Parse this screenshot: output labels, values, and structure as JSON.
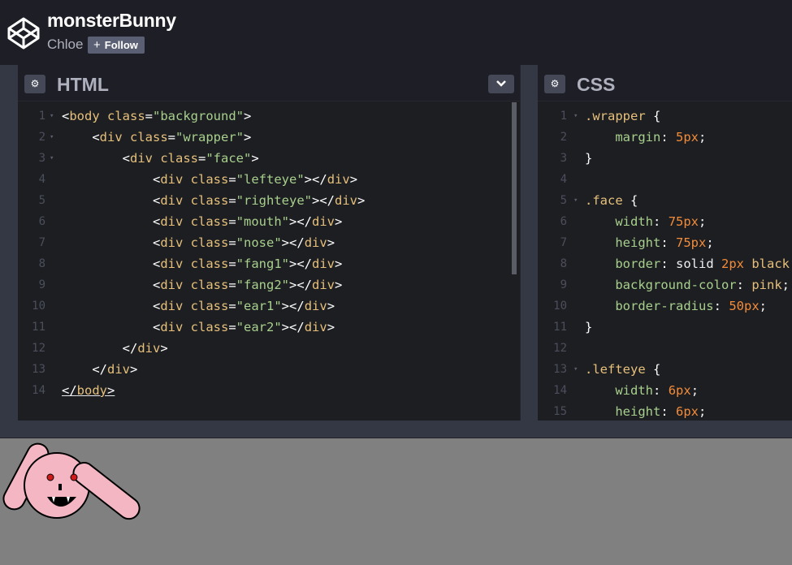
{
  "header": {
    "pen_title": "monsterBunny",
    "author": "Chloe",
    "follow_label": "Follow",
    "follow_icon": "plus-icon",
    "logo_icon": "codepen-logo-icon"
  },
  "html_editor": {
    "title": "HTML",
    "settings_icon": "gear-icon",
    "collapse_icon": "chevron-down-icon",
    "line_numbers": [
      "1",
      "2",
      "3",
      "4",
      "5",
      "6",
      "7",
      "8",
      "9",
      "10",
      "11",
      "12",
      "13",
      "14"
    ],
    "lines": [
      "<body class=\"background\">",
      "    <div class=\"wrapper\">",
      "        <div class=\"face\">",
      "            <div class=\"lefteye\"></div>",
      "            <div class=\"righteye\"></div>",
      "            <div class=\"mouth\"></div>",
      "            <div class=\"nose\"></div>",
      "            <div class=\"fang1\"></div>",
      "            <div class=\"fang2\"></div>",
      "            <div class=\"ear1\"></div>",
      "            <div class=\"ear2\"></div>",
      "        </div>",
      "    </div>",
      "</body>"
    ]
  },
  "css_editor": {
    "title": "CSS",
    "settings_icon": "gear-icon",
    "line_numbers": [
      "1",
      "2",
      "3",
      "4",
      "5",
      "6",
      "7",
      "8",
      "9",
      "10",
      "11",
      "12",
      "13",
      "14",
      "15"
    ],
    "lines": [
      ".wrapper {",
      "    margin: 5px;",
      "}",
      "",
      ".face {",
      "    width: 75px;",
      "    height: 75px;",
      "    border: solid 2px black;",
      "    background-color: pink;",
      "    border-radius: 50px;",
      "}",
      "",
      ".lefteye {",
      "    width: 6px;",
      "    height: 6px;"
    ]
  },
  "result": {
    "background_color": "#808080",
    "bunny_color": "#f4b6c2",
    "eye_color": "#d11a1a"
  }
}
